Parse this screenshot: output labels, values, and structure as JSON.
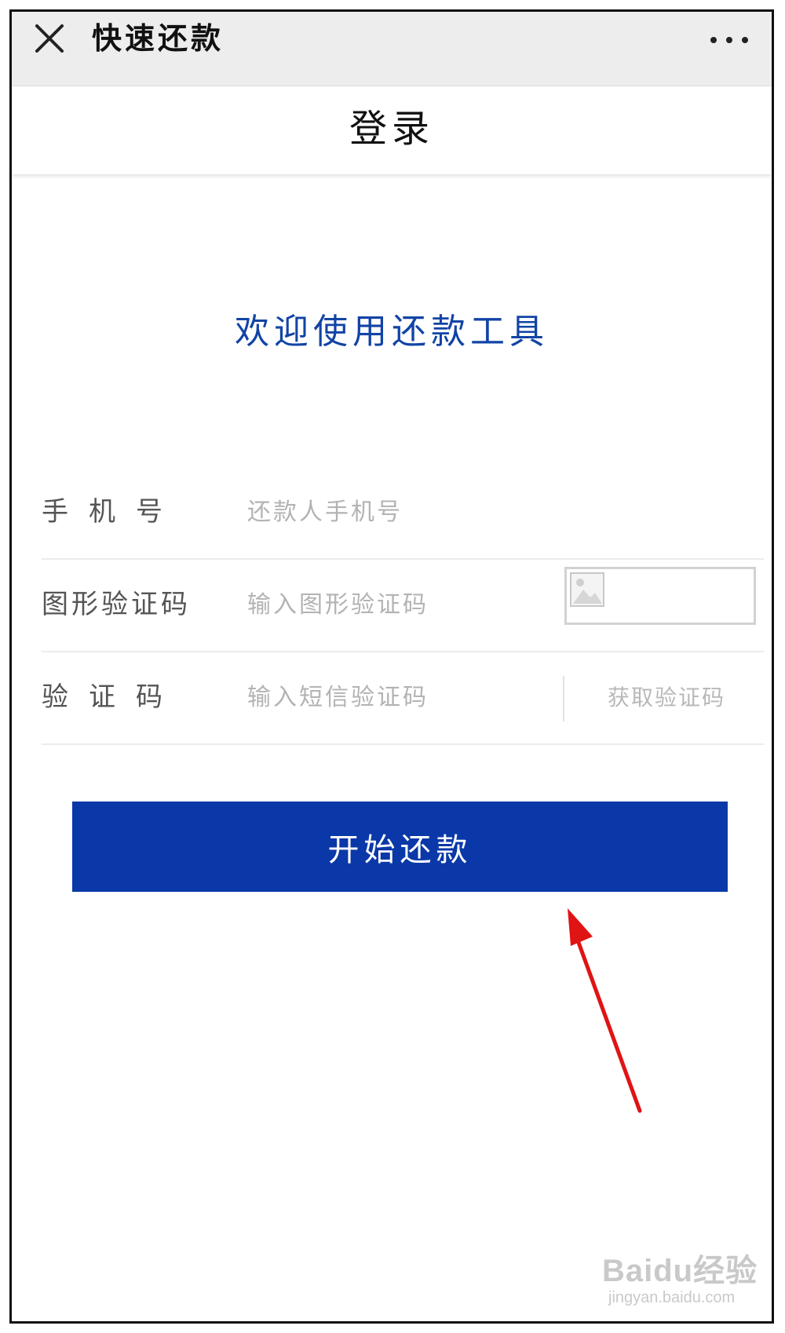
{
  "app": {
    "title": "快速还款"
  },
  "nav": {
    "title": "登录"
  },
  "welcome_text": "欢迎使用还款工具",
  "form": {
    "phone": {
      "label": "手机号",
      "placeholder": "还款人手机号"
    },
    "captcha": {
      "label": "图形验证码",
      "placeholder": "输入图形验证码"
    },
    "sms": {
      "label": "验证码",
      "placeholder": "输入短信验证码",
      "button": "获取验证码"
    }
  },
  "submit_label": "开始还款",
  "annotation": {
    "arrow_color": "#e01414"
  },
  "colors": {
    "accent": "#0a38a8",
    "welcome": "#1244a6",
    "topbar": "#ededed"
  },
  "icons": {
    "close": "close-icon",
    "more": "more-icon",
    "captcha_image": "broken-image-icon"
  },
  "watermark": {
    "logo": "Baidu经验",
    "url": "jingyan.baidu.com"
  }
}
